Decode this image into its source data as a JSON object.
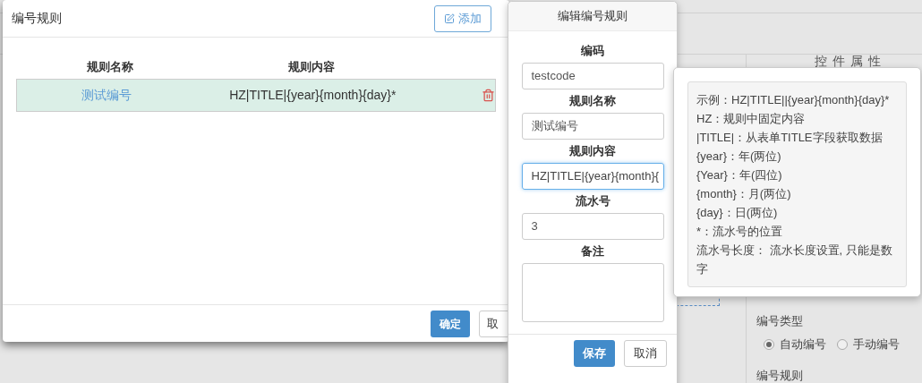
{
  "background": {
    "panel_title": "控件属性",
    "number_type_label": "编号类型",
    "number_type_options": [
      {
        "label": "自动编号",
        "selected": true
      },
      {
        "label": "手动编号",
        "selected": false
      }
    ],
    "number_rule_label": "编号规则"
  },
  "modal": {
    "title": "编号规则",
    "add_button": "添加",
    "columns": [
      "规则名称",
      "规则内容"
    ],
    "rows": [
      {
        "name": "测试编号",
        "content": "HZ|TITLE|{year}{month}{day}*",
        "selected": true
      }
    ],
    "buttons": {
      "confirm": "确定",
      "cancel": "取"
    }
  },
  "popover": {
    "title": "编辑编号规则",
    "fields": [
      {
        "label": "编码",
        "kind": "input",
        "value": "testcode",
        "focused": false
      },
      {
        "label": "规则名称",
        "kind": "input",
        "value": "测试编号",
        "focused": false
      },
      {
        "label": "规则内容",
        "kind": "input",
        "value": "HZ|TITLE|{year}{month}{",
        "focused": true
      },
      {
        "label": "流水号",
        "kind": "input",
        "value": "3",
        "focused": false
      },
      {
        "label": "备注",
        "kind": "textarea",
        "focused": false
      }
    ],
    "buttons": {
      "save": "保存",
      "cancel": "取消"
    }
  },
  "tooltip": {
    "lines": [
      "示例：HZ|TITLE||{year}{month}{day}*",
      "HZ：规则中固定内容",
      "|TITLE|：从表单TITLE字段获取数据",
      "{year}：年(两位)",
      "{Year}：年(四位)",
      "{month}：月(两位)",
      "{day}：日(两位)",
      "*：流水号的位置",
      "流水号长度： 流水长度设置, 只能是数字"
    ]
  }
}
